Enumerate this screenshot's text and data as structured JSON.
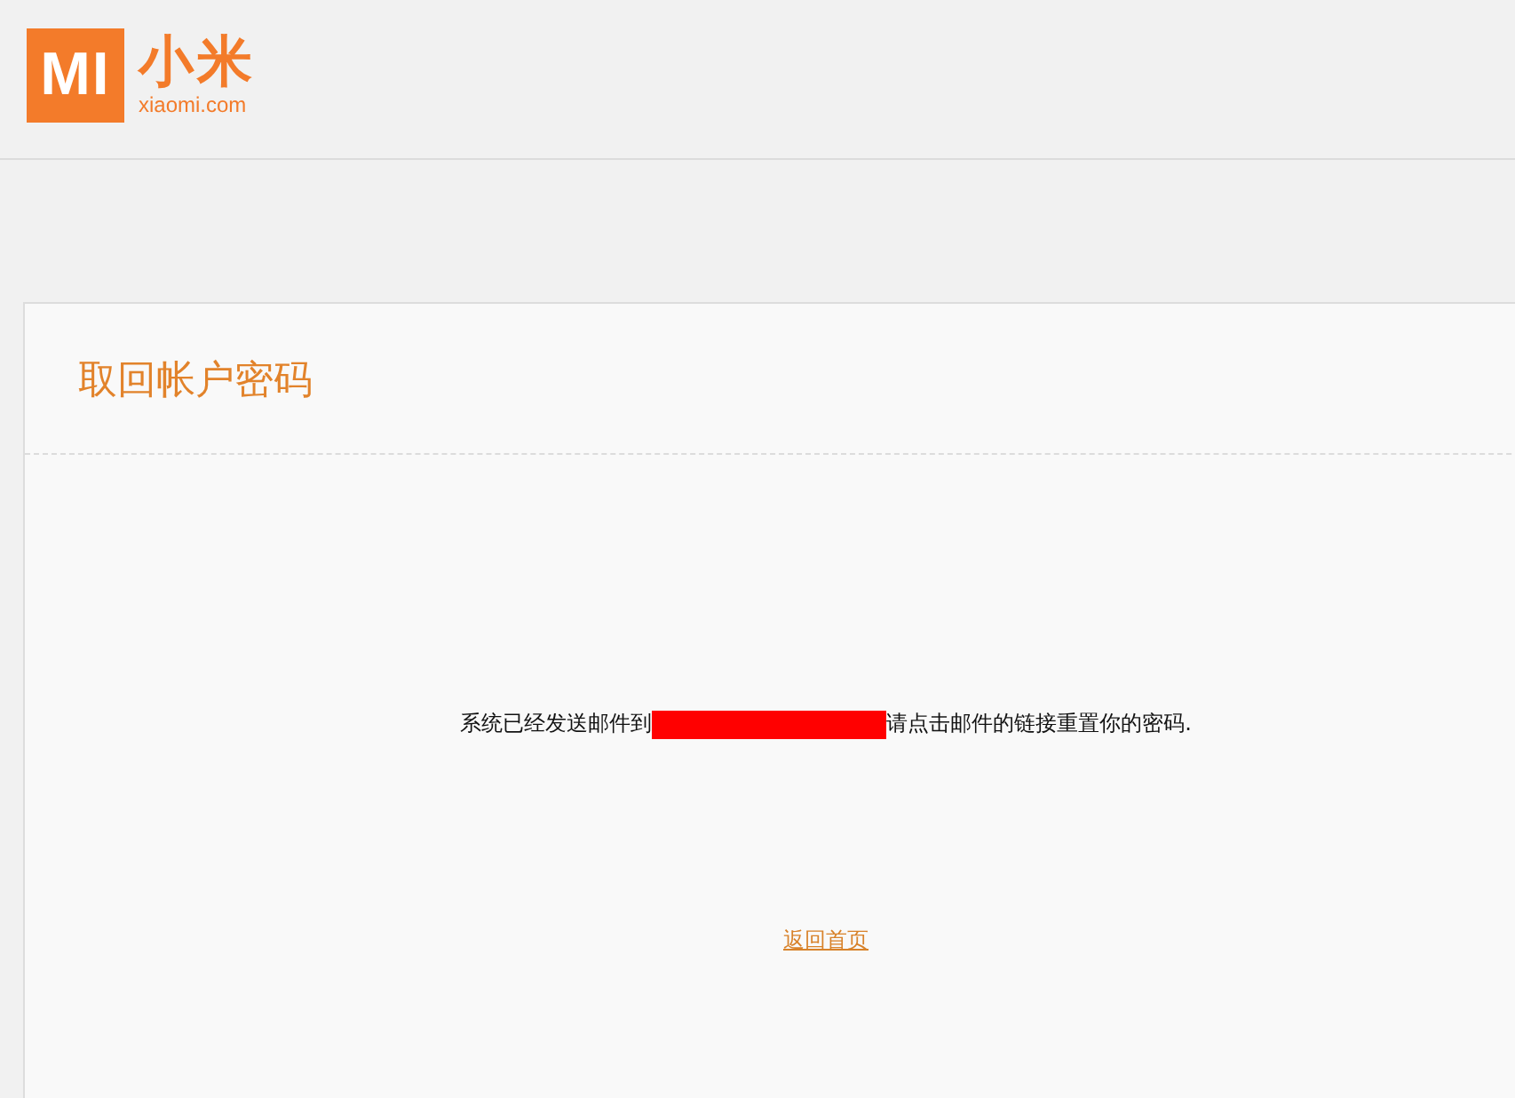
{
  "header": {
    "logo_mark": "MI",
    "logo_name": "小米",
    "logo_domain": "xiaomi.com"
  },
  "card": {
    "title": "取回帐户密码",
    "message": [
      {
        "kind": "text",
        "text": "系统已经发送邮件到"
      },
      {
        "kind": "redaction"
      },
      {
        "kind": "text",
        "text": "请点击邮件的链接重置你的密码."
      }
    ],
    "link": "返回首页"
  }
}
